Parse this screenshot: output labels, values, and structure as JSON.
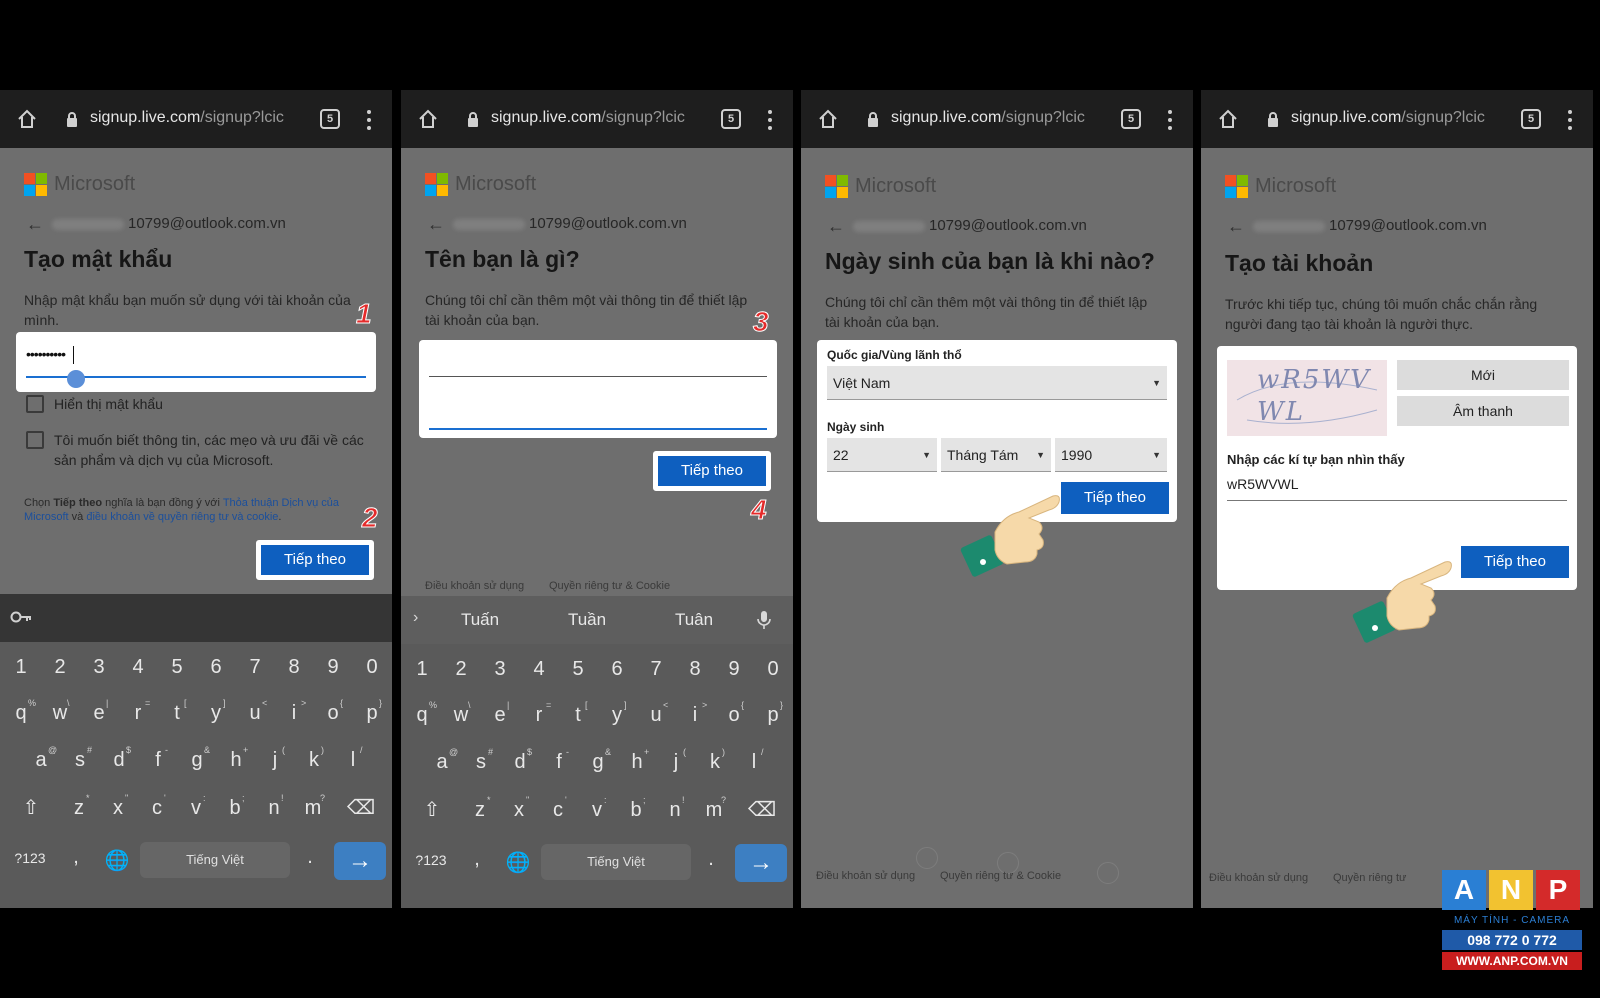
{
  "browser": {
    "url_host": "signup.live.com",
    "url_path": "/signup?lcic",
    "tab_count": "5"
  },
  "brand": {
    "name": "Microsoft"
  },
  "email_suffix": "10799@outlook.com.vn",
  "colors": {
    "primary_button": "#0e5fbf",
    "step_number": "#e52b2b",
    "panel_overlay": "#6e6e6e"
  },
  "panel1": {
    "title": "Tạo mật khẩu",
    "description": "Nhập mật khẩu bạn muốn sử dụng với tài khoản của mình.",
    "password_value": "••••••••••",
    "show_password_label": "Hiển thị mật khẩu",
    "newsletter_label": "Tôi muốn biết thông tin, các mẹo và ưu đãi về các sản phẩm và dịch vụ của Microsoft.",
    "terms_prefix": "Chọn ",
    "terms_bold": "Tiếp theo",
    "terms_mid": " nghĩa là bạn đồng ý với ",
    "terms_link1": "Thỏa thuận Dịch vụ của Microsoft",
    "terms_and": " và ",
    "terms_link2": "điều khoản về quyền riêng tư và cookie",
    "terms_end": ".",
    "next_button": "Tiếp theo",
    "step_a": "1",
    "step_b": "2"
  },
  "panel2": {
    "title": "Tên bạn là gì?",
    "description": "Chúng tôi chỉ cần thêm một vài thông tin để thiết lập tài khoản của bạn.",
    "next_button": "Tiếp theo",
    "step_a": "3",
    "step_b": "4",
    "footer_terms": "Điều khoản sử dụng",
    "footer_privacy": "Quyền riêng tư & Cookie",
    "suggestions": [
      "Tuấn",
      "Tuần",
      "Tuân"
    ]
  },
  "panel3": {
    "title": "Ngày sinh của bạn là khi nào?",
    "description": "Chúng tôi chỉ cần thêm một vài thông tin để thiết lập tài khoản của bạn.",
    "country_label": "Quốc gia/Vùng lãnh thổ",
    "country_value": "Việt Nam",
    "birthdate_label": "Ngày sinh",
    "day_value": "22",
    "month_value": "Tháng Tám",
    "year_value": "1990",
    "next_button": "Tiếp theo",
    "footer_terms": "Điều khoản sử dụng",
    "footer_privacy": "Quyền riêng tư & Cookie"
  },
  "panel4": {
    "title": "Tạo tài khoản",
    "description": "Trước khi tiếp tục, chúng tôi muốn chắc chắn rằng người đang tạo tài khoản là người thực.",
    "captcha_text": "wR5WVWL",
    "new_button": "Mới",
    "audio_button": "Âm thanh",
    "captcha_label": "Nhập các kí tự bạn nhìn thấy",
    "captcha_value": "wR5WVWL",
    "next_button": "Tiếp theo",
    "footer_terms": "Điều khoản sử dụng",
    "footer_privacy": "Quyền riêng tư"
  },
  "keyboard": {
    "number_row": [
      "1",
      "2",
      "3",
      "4",
      "5",
      "6",
      "7",
      "8",
      "9",
      "0"
    ],
    "row1": [
      "q",
      "w",
      "e",
      "r",
      "t",
      "y",
      "u",
      "i",
      "o",
      "p"
    ],
    "row1_alt": [
      "%",
      "\\",
      "|",
      "=",
      "[",
      "]",
      "<",
      ">",
      "{",
      "}"
    ],
    "row2": [
      "a",
      "s",
      "d",
      "f",
      "g",
      "h",
      "j",
      "k",
      "l"
    ],
    "row2_alt": [
      "@",
      "#",
      "$",
      "-",
      "&",
      "+",
      "(",
      ")",
      "/"
    ],
    "row3": [
      "z",
      "x",
      "c",
      "v",
      "b",
      "n",
      "m"
    ],
    "row3_alt": [
      "*",
      "\"",
      "'",
      ":",
      ";",
      "!",
      "?"
    ],
    "symbols_key": "?123",
    "comma_key": ",",
    "period_key": ".",
    "space_label": "Tiếng Việt",
    "enter_icon": "→"
  },
  "watermark": {
    "letters": [
      "A",
      "N",
      "P"
    ],
    "letter_colors": [
      "#2a7fd4",
      "#f2c230",
      "#d42a2a"
    ],
    "tagline": "MÁY TÍNH - CAMERA",
    "phone": "098 772 0 772",
    "website": "WWW.ANP.COM.VN"
  }
}
